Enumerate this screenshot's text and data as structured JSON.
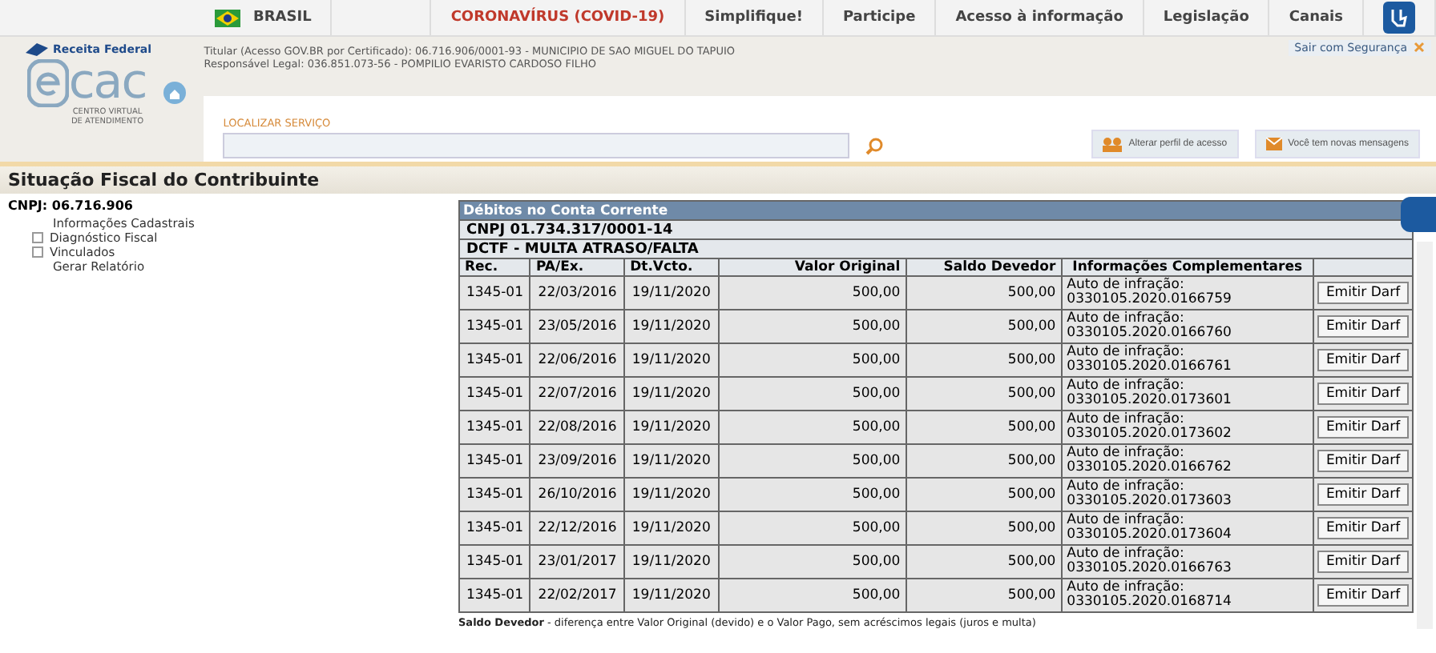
{
  "top_nav": {
    "country": "BRASIL",
    "links": [
      {
        "label": "CORONAVÍRUS (COVID-19)",
        "kind": "alert"
      },
      {
        "label": "Simplifique!",
        "kind": "normal"
      },
      {
        "label": "Participe",
        "kind": "normal"
      },
      {
        "label": "Acesso à informação",
        "kind": "normal"
      },
      {
        "label": "Legislação",
        "kind": "normal"
      },
      {
        "label": "Canais",
        "kind": "normal"
      }
    ]
  },
  "header": {
    "agency": "Receita Federal",
    "logo_text": "cac",
    "logo_subtitle": "CENTRO VIRTUAL DE ATENDIMENTO",
    "holder_line": "Titular (Acesso GOV.BR por Certificado): 06.716.906/0001-93 - MUNICIPIO DE SAO MIGUEL DO TAPUIO",
    "responsible_line": "Responsável Legal: 036.851.073-56 - POMPILIO EVARISTO CARDOSO FILHO",
    "logout": "Sair com Segurança",
    "search": {
      "label": "LOCALIZAR SERVIÇO"
    },
    "actions": [
      {
        "label": "Alterar perfil de acesso",
        "kind": "profile"
      },
      {
        "label": "Você tem novas mensagens",
        "kind": "mail"
      }
    ]
  },
  "page_title": "Situação Fiscal do Contribuinte",
  "sidebar": {
    "cnpj": "CNPJ: 06.716.906",
    "items": [
      {
        "label": "Informações Cadastrais",
        "expandable": false
      },
      {
        "label": "Diagnóstico Fiscal",
        "expandable": true
      },
      {
        "label": "Vinculados",
        "expandable": true
      },
      {
        "label": "Gerar Relatório",
        "expandable": false
      }
    ]
  },
  "table": {
    "title": "Débitos no Conta Corrente",
    "cnpj": "CNPJ 01.734.317/0001-14",
    "group": "DCTF - MULTA ATRASO/FALTA",
    "columns": [
      "Rec.",
      "PA/Ex.",
      "Dt.Vcto.",
      "Valor Original",
      "Saldo Devedor",
      "Informações Complementares"
    ],
    "rows": [
      {
        "rec": "1345-01",
        "pa": "22/03/2016",
        "due": "19/11/2020",
        "original": "500,00",
        "balance": "500,00",
        "info_label": "Auto de infração:",
        "info_number": "0330105.2020.0166759",
        "button": "Emitir Darf"
      },
      {
        "rec": "1345-01",
        "pa": "23/05/2016",
        "due": "19/11/2020",
        "original": "500,00",
        "balance": "500,00",
        "info_label": "Auto de infração:",
        "info_number": "0330105.2020.0166760",
        "button": "Emitir Darf"
      },
      {
        "rec": "1345-01",
        "pa": "22/06/2016",
        "due": "19/11/2020",
        "original": "500,00",
        "balance": "500,00",
        "info_label": "Auto de infração:",
        "info_number": "0330105.2020.0166761",
        "button": "Emitir Darf"
      },
      {
        "rec": "1345-01",
        "pa": "22/07/2016",
        "due": "19/11/2020",
        "original": "500,00",
        "balance": "500,00",
        "info_label": "Auto de infração:",
        "info_number": "0330105.2020.0173601",
        "button": "Emitir Darf"
      },
      {
        "rec": "1345-01",
        "pa": "22/08/2016",
        "due": "19/11/2020",
        "original": "500,00",
        "balance": "500,00",
        "info_label": "Auto de infração:",
        "info_number": "0330105.2020.0173602",
        "button": "Emitir Darf"
      },
      {
        "rec": "1345-01",
        "pa": "23/09/2016",
        "due": "19/11/2020",
        "original": "500,00",
        "balance": "500,00",
        "info_label": "Auto de infração:",
        "info_number": "0330105.2020.0166762",
        "button": "Emitir Darf"
      },
      {
        "rec": "1345-01",
        "pa": "26/10/2016",
        "due": "19/11/2020",
        "original": "500,00",
        "balance": "500,00",
        "info_label": "Auto de infração:",
        "info_number": "0330105.2020.0173603",
        "button": "Emitir Darf"
      },
      {
        "rec": "1345-01",
        "pa": "22/12/2016",
        "due": "19/11/2020",
        "original": "500,00",
        "balance": "500,00",
        "info_label": "Auto de infração:",
        "info_number": "0330105.2020.0173604",
        "button": "Emitir Darf"
      },
      {
        "rec": "1345-01",
        "pa": "23/01/2017",
        "due": "19/11/2020",
        "original": "500,00",
        "balance": "500,00",
        "info_label": "Auto de infração:",
        "info_number": "0330105.2020.0166763",
        "button": "Emitir Darf"
      },
      {
        "rec": "1345-01",
        "pa": "22/02/2017",
        "due": "19/11/2020",
        "original": "500,00",
        "balance": "500,00",
        "info_label": "Auto de infração:",
        "info_number": "0330105.2020.0168714",
        "button": "Emitir Darf"
      }
    ],
    "footnote": "**Saldo Devedor** - diferença entre Valor Original (devido) e o Valor Pago, sem acréscimos legais (juros e multa)"
  }
}
